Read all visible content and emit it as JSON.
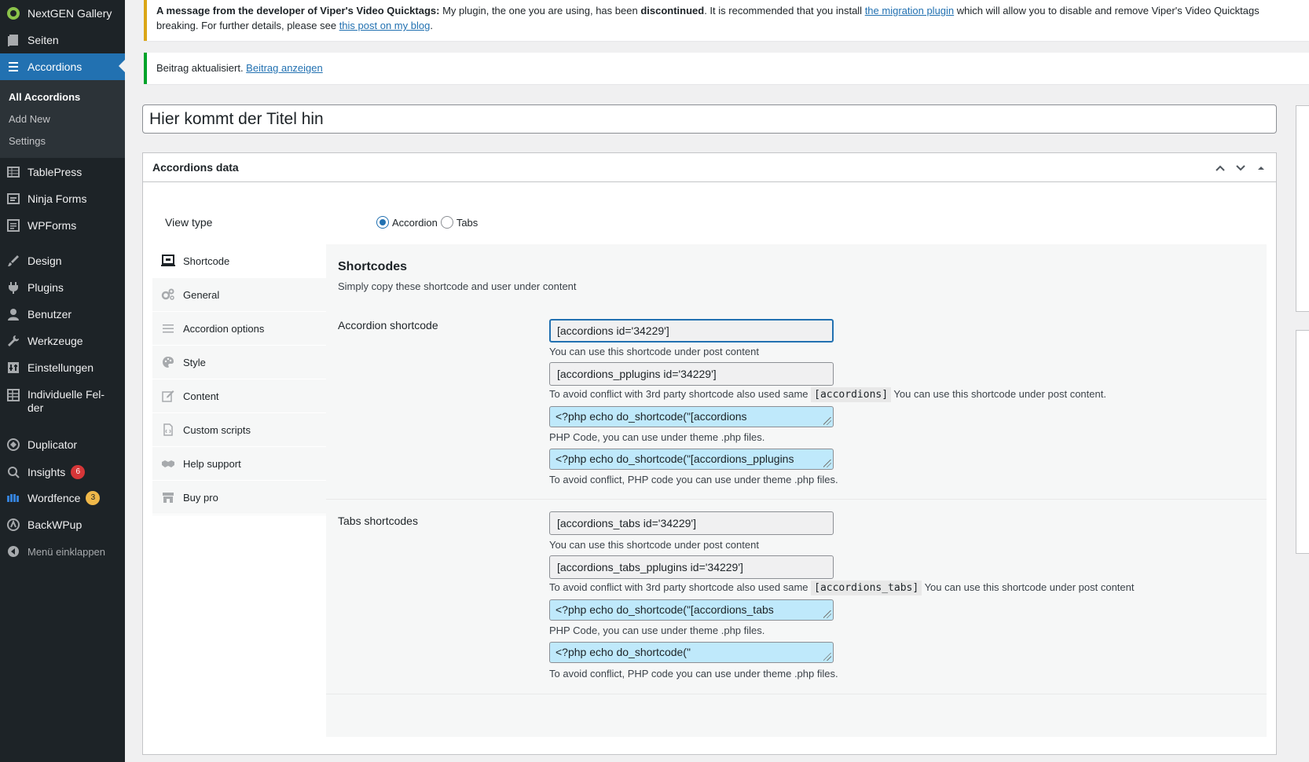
{
  "sidebar": {
    "items": [
      {
        "label": "NextGEN Gallery",
        "icon": "nextgen-icon"
      },
      {
        "label": "Seiten",
        "icon": "pages-icon"
      },
      {
        "label": "Accordions",
        "icon": "accordions-icon"
      },
      {
        "label": "TablePress",
        "icon": "tablepress-icon"
      },
      {
        "label": "Ninja Forms",
        "icon": "ninja-forms-icon"
      },
      {
        "label": "WPForms",
        "icon": "wpforms-icon"
      },
      {
        "label": "Design",
        "icon": "paintbrush-icon"
      },
      {
        "label": "Plugins",
        "icon": "plugins-icon"
      },
      {
        "label": "Benutzer",
        "icon": "users-icon"
      },
      {
        "label": "Werkzeuge",
        "icon": "wrench-icon"
      },
      {
        "label": "Einstellungen",
        "icon": "settings-icon"
      },
      {
        "label": "Individuelle Fel-der",
        "icon": "custom-fields-icon"
      },
      {
        "label": "Duplicator",
        "icon": "duplicator-icon"
      },
      {
        "label": "Insights",
        "icon": "insights-icon",
        "badge": "6"
      },
      {
        "label": "Wordfence",
        "icon": "wordfence-icon",
        "badge": "3"
      },
      {
        "label": "BackWPup",
        "icon": "backwpup-icon"
      },
      {
        "label": "Menü einklappen",
        "icon": "collapse-icon"
      }
    ],
    "submenu": [
      "All Accordions",
      "Add New",
      "Settings"
    ]
  },
  "notices": {
    "warn_bold": "A message from the developer of Viper's Video Quicktags:",
    "warn_text1": " My plugin, the one you are using, has been ",
    "warn_bold2": "discontinued",
    "warn_text2": ". It is recommended that you install ",
    "warn_link1": "the migration plugin",
    "warn_text3": " which will allow you to disable and remove Viper's Video Quicktags",
    "warn_text4": "breaking. For further details, please see ",
    "warn_link2": "this post on my blog",
    "warn_text5": ".",
    "success_text": "Beitrag aktualisiert. ",
    "success_link": "Beitrag anzeigen"
  },
  "title_input": {
    "placeholder": "Hier kommt der Titel hin"
  },
  "postbox": {
    "title": "Accordions data",
    "view_type_label": "View type",
    "radio_accordion": "Accordion",
    "radio_tabs": "Tabs",
    "tabs": [
      {
        "label": "Shortcode",
        "icon": "shortcode-icon"
      },
      {
        "label": "General",
        "icon": "gears-icon"
      },
      {
        "label": "Accordion options",
        "icon": "list-icon"
      },
      {
        "label": "Style",
        "icon": "palette-icon"
      },
      {
        "label": "Content",
        "icon": "edit-icon"
      },
      {
        "label": "Custom scripts",
        "icon": "file-code-icon"
      },
      {
        "label": "Help support",
        "icon": "handshake-icon"
      },
      {
        "label": "Buy pro",
        "icon": "store-icon"
      }
    ],
    "panel": {
      "heading": "Shortcodes",
      "description": "Simply copy these shortcode and user under content",
      "accordion_label": "Accordion shortcode",
      "acc_sc1": "[accordions id='34229']",
      "acc_hint1": "You can use this shortcode under post content",
      "acc_sc2": "[accordions_pplugins id='34229']",
      "acc_hint2_pre": "To avoid conflict with 3rd party shortcode also used same ",
      "acc_hint2_code": "[accordions]",
      "acc_hint2_post": " You can use this shortcode under post content.",
      "acc_php1": "<?php echo do_shortcode(\"[accordions",
      "acc_hint3": "PHP Code, you can use under theme .php files.",
      "acc_php2": "<?php echo do_shortcode(\"[accordions_pplugins",
      "acc_hint4": "To avoid conflict, PHP code you can use under theme .php files.",
      "tabs_label": "Tabs shortcodes",
      "tab_sc1": "[accordions_tabs id='34229']",
      "tab_hint1": "You can use this shortcode under post content",
      "tab_sc2": "[accordions_tabs_pplugins id='34229']",
      "tab_hint2_pre": "To avoid conflict with 3rd party shortcode also used same ",
      "tab_hint2_code": "[accordions_tabs]",
      "tab_hint2_post": " You can use this shortcode under post content",
      "tab_php1": "<?php echo do_shortcode(\"[accordions_tabs",
      "tab_hint3": "PHP Code, you can use under theme .php files.",
      "tab_php2": "<?php echo do_shortcode(\"",
      "tab_hint4": "To avoid conflict, PHP code you can use under theme .php files."
    }
  },
  "colors": {
    "accent": "#2271b1",
    "sidebar": "#1d2327",
    "highlight": "#bfe9fb"
  }
}
